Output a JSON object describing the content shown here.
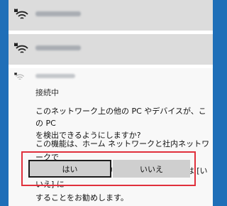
{
  "colors": {
    "desktop": "#1f6fb8",
    "flyout_bg": "#f2f2f2",
    "row_bg": "#dcdcdc",
    "highlight_border": "#e0303c"
  },
  "networks": [
    {
      "icon": "wifi-secured-icon"
    },
    {
      "icon": "wifi-secured-icon"
    }
  ],
  "connected_network": {
    "icon": "wifi-secured-icon",
    "status": "接続中"
  },
  "discovery": {
    "prompt": "このネットワーク上の他の PC やデバイスが、この PC\nを検出できるようにしますか?",
    "info": "この機能は、ホーム ネットワークと社内ネットワークで\n[はい] にして、パブリック ネットワークでは [いいえ] に\nすることをお勧めします。",
    "yes_label": "はい",
    "no_label": "いいえ"
  }
}
